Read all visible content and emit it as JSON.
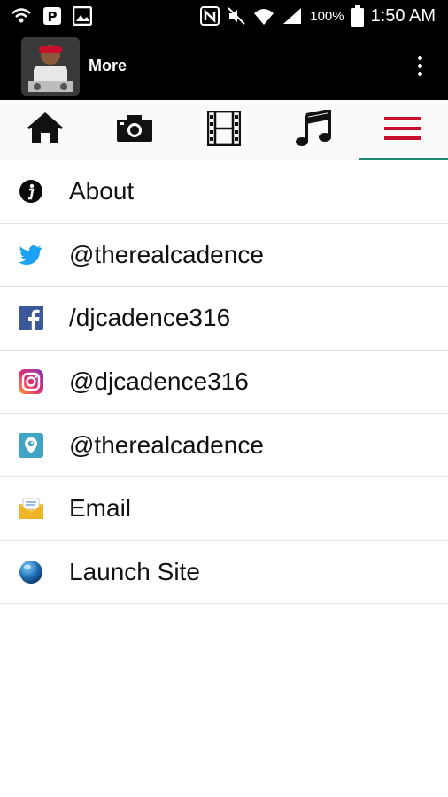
{
  "status_bar": {
    "battery_percent": "100%",
    "time": "1:50 AM",
    "icons": [
      "wifi-call-icon",
      "parking-icon",
      "gallery-icon",
      "nfc-icon",
      "mute-icon",
      "wifi-icon",
      "signal-icon",
      "battery-icon"
    ]
  },
  "app_bar": {
    "title": "More",
    "menu_icon": "overflow-menu-icon"
  },
  "tabs": [
    {
      "icon": "home-icon",
      "active": false
    },
    {
      "icon": "camera-icon",
      "active": false
    },
    {
      "icon": "film-icon",
      "active": false
    },
    {
      "icon": "music-icon",
      "active": false
    },
    {
      "icon": "menu-icon",
      "active": true
    }
  ],
  "menu": {
    "items": [
      {
        "label": "About",
        "icon": "info-icon"
      },
      {
        "label": "@therealcadence",
        "icon": "twitter-icon"
      },
      {
        "label": "/djcadence316",
        "icon": "facebook-icon"
      },
      {
        "label": "@djcadence316",
        "icon": "instagram-icon"
      },
      {
        "label": "@therealcadence",
        "icon": "periscope-icon"
      },
      {
        "label": "Email",
        "icon": "email-icon"
      },
      {
        "label": "Launch Site",
        "icon": "globe-icon"
      }
    ]
  },
  "colors": {
    "tab_indicator": "#1f8a70",
    "active_tab_icon": "#c8102e",
    "twitter": "#1da1f2",
    "facebook": "#3b5998"
  }
}
